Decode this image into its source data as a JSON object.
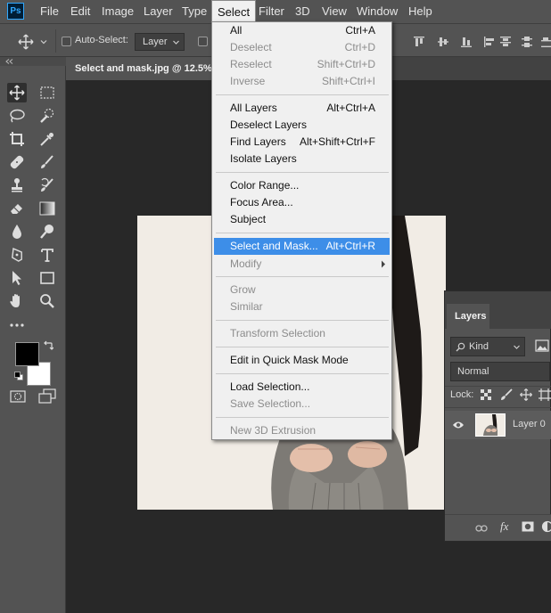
{
  "menubar": {
    "logo": "Ps",
    "items": [
      "File",
      "Edit",
      "Image",
      "Layer",
      "Type",
      "Select",
      "Filter",
      "3D",
      "View",
      "Window",
      "Help"
    ],
    "active": "Select"
  },
  "options": {
    "auto_select_label": "Auto-Select:",
    "auto_select_value": "Layer"
  },
  "document": {
    "tab_title": "Select and mask.jpg @ 12.5%"
  },
  "select_menu": {
    "groups": [
      [
        {
          "label": "All",
          "shortcut": "Ctrl+A",
          "enabled": true
        },
        {
          "label": "Deselect",
          "shortcut": "Ctrl+D",
          "enabled": false
        },
        {
          "label": "Reselect",
          "shortcut": "Shift+Ctrl+D",
          "enabled": false
        },
        {
          "label": "Inverse",
          "shortcut": "Shift+Ctrl+I",
          "enabled": false
        }
      ],
      [
        {
          "label": "All Layers",
          "shortcut": "Alt+Ctrl+A",
          "enabled": true
        },
        {
          "label": "Deselect Layers",
          "shortcut": "",
          "enabled": true
        },
        {
          "label": "Find Layers",
          "shortcut": "Alt+Shift+Ctrl+F",
          "enabled": true
        },
        {
          "label": "Isolate Layers",
          "shortcut": "",
          "enabled": true
        }
      ],
      [
        {
          "label": "Color Range...",
          "shortcut": "",
          "enabled": true
        },
        {
          "label": "Focus Area...",
          "shortcut": "",
          "enabled": true
        },
        {
          "label": "Subject",
          "shortcut": "",
          "enabled": true
        }
      ],
      [
        {
          "label": "Select and Mask...",
          "shortcut": "Alt+Ctrl+R",
          "enabled": true,
          "highlighted": true
        },
        {
          "label": "Modify",
          "shortcut": "",
          "enabled": false,
          "submenu": true
        }
      ],
      [
        {
          "label": "Grow",
          "shortcut": "",
          "enabled": false
        },
        {
          "label": "Similar",
          "shortcut": "",
          "enabled": false
        }
      ],
      [
        {
          "label": "Transform Selection",
          "shortcut": "",
          "enabled": false
        }
      ],
      [
        {
          "label": "Edit in Quick Mask Mode",
          "shortcut": "",
          "enabled": true
        }
      ],
      [
        {
          "label": "Load Selection...",
          "shortcut": "",
          "enabled": true
        },
        {
          "label": "Save Selection...",
          "shortcut": "",
          "enabled": false
        }
      ],
      [
        {
          "label": "New 3D Extrusion",
          "shortcut": "",
          "enabled": false
        }
      ]
    ]
  },
  "layers_panel": {
    "tab": "Layers",
    "filter": "Kind",
    "blend_mode": "Normal",
    "lock_label": "Lock:",
    "layer_name": "Layer 0"
  },
  "colors": {
    "ui_bg": "#535353",
    "highlight": "#3d8ee8",
    "canvas_bg": "#f1ece5"
  }
}
